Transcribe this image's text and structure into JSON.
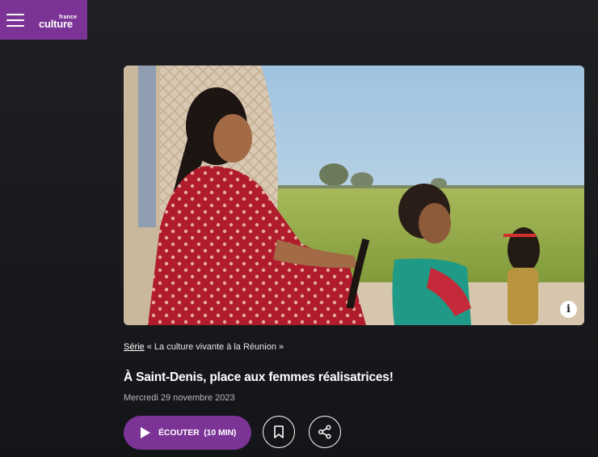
{
  "header": {
    "menu_icon": "hamburger-menu-icon",
    "logo_small": "france",
    "logo_big": "culture",
    "brand_color": "#7b3396"
  },
  "hero": {
    "info_icon": "info-icon",
    "info_label": "i"
  },
  "episode": {
    "serie_link": "Série",
    "serie_name": " « La culture vivante à la Réunion »",
    "title": "À Saint-Denis, place aux femmes réalisatrices!",
    "date": "Mercredi 29 novembre 2023"
  },
  "actions": {
    "listen_label": "ÉCOUTER",
    "listen_duration": "(10 MIN)",
    "play_icon": "play-icon",
    "bookmark_icon": "bookmark-icon",
    "share_icon": "share-icon"
  }
}
